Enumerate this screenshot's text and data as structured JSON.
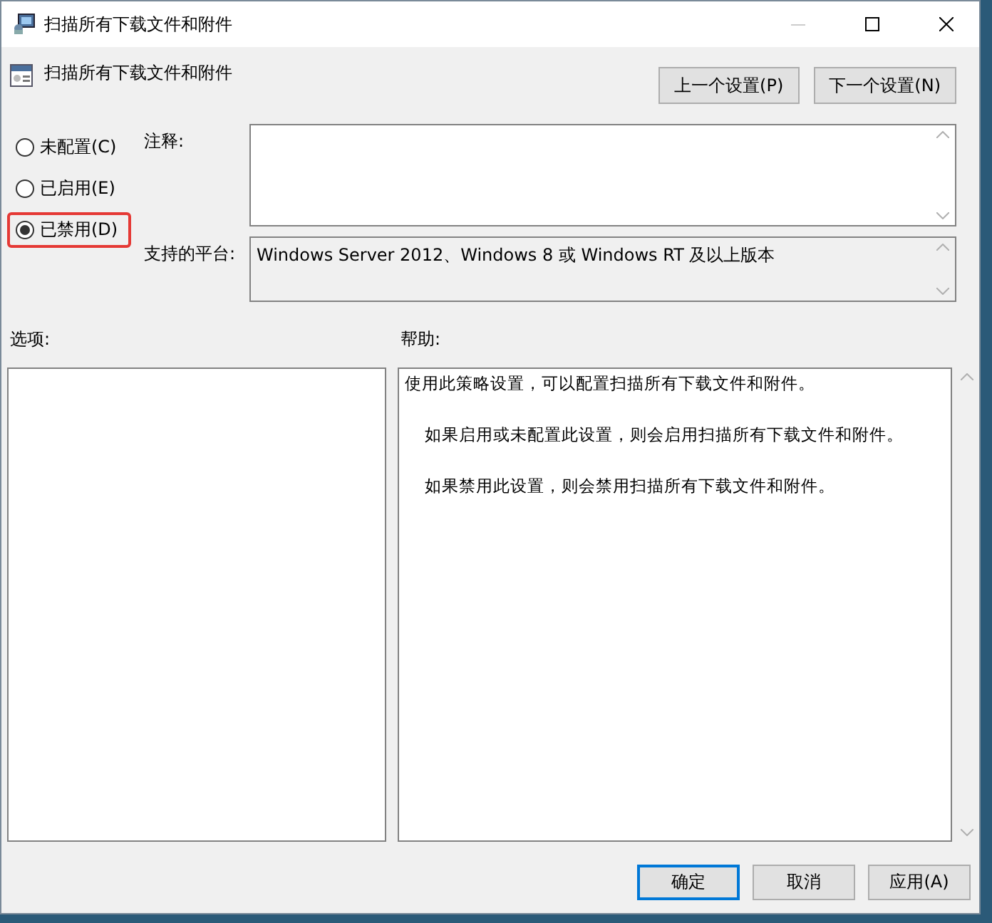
{
  "window": {
    "title": "扫描所有下载文件和附件"
  },
  "header": {
    "title": "扫描所有下载文件和附件"
  },
  "nav_buttons": [
    "上一个设置(P)",
    "下一个设置(N)"
  ],
  "options": [
    {
      "label": "未配置(C)",
      "selected": false,
      "highlighted": false
    },
    {
      "label": "已启用(E)",
      "selected": false,
      "highlighted": false
    },
    {
      "label": "已禁用(D)",
      "selected": true,
      "highlighted": true
    }
  ],
  "comment": {
    "label": "注释:"
  },
  "platform": {
    "label": "支持的平台:",
    "value": "Windows Server 2012、Windows 8 或 Windows RT 及以上版本"
  },
  "options_label": "选项:",
  "help": {
    "label": "帮助:",
    "paragraphs": [
      {
        "text": "使用此策略设置，可以配置扫描所有下载文件和附件。",
        "indented": false
      },
      {
        "text": "如果启用或未配置此设置，则会启用扫描所有下载文件和附件。",
        "indented": true
      },
      {
        "text": "如果禁用此设置，则会禁用扫描所有下载文件和附件。",
        "indented": true
      }
    ]
  },
  "footer_buttons": [
    {
      "label": "确定",
      "default": true
    },
    {
      "label": "取消",
      "default": false
    },
    {
      "label": "应用(A)",
      "default": false
    }
  ]
}
